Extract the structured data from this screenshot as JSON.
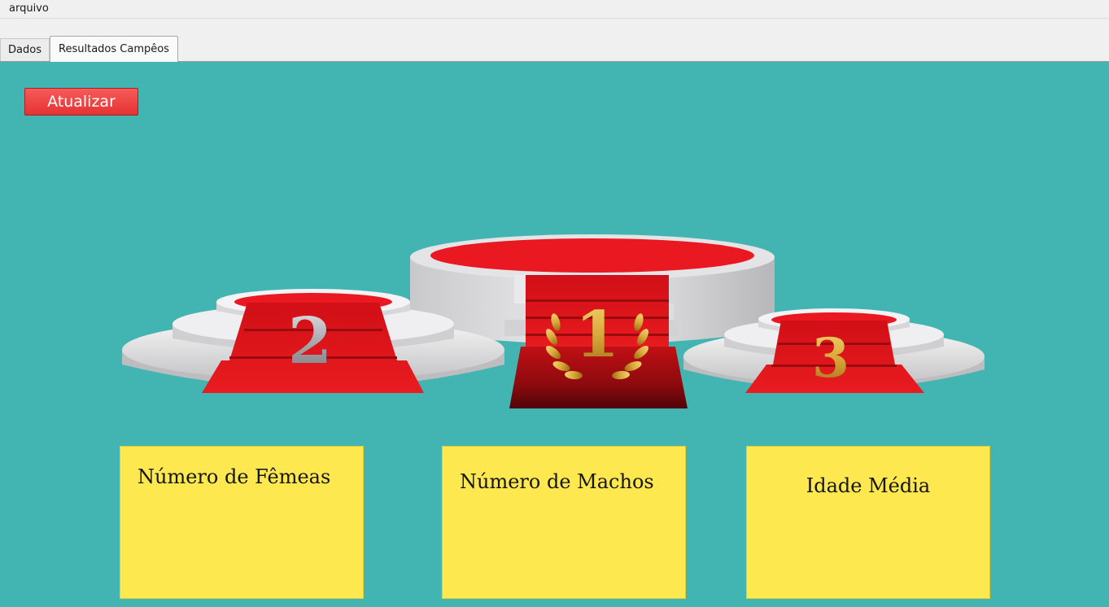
{
  "menubar": {
    "items": [
      {
        "label": "arquivo"
      }
    ]
  },
  "tabs": [
    {
      "label": "Dados",
      "active": false
    },
    {
      "label": "Resultados Campêos",
      "active": true
    }
  ],
  "toolbar": {
    "refresh_label": "Atualizar"
  },
  "podium": {
    "places": [
      {
        "rank": "1"
      },
      {
        "rank": "2"
      },
      {
        "rank": "3"
      }
    ]
  },
  "cards": [
    {
      "label": "Número de Fêmeas"
    },
    {
      "label": "Número de Machos"
    },
    {
      "label": "Idade Média"
    }
  ],
  "colors": {
    "background": "#42b5b2",
    "card": "#fde84f",
    "button": "#ec3a3a",
    "carpet": "#e8161b",
    "gold": "#d9a93a",
    "silver": "#b9b9bd"
  }
}
